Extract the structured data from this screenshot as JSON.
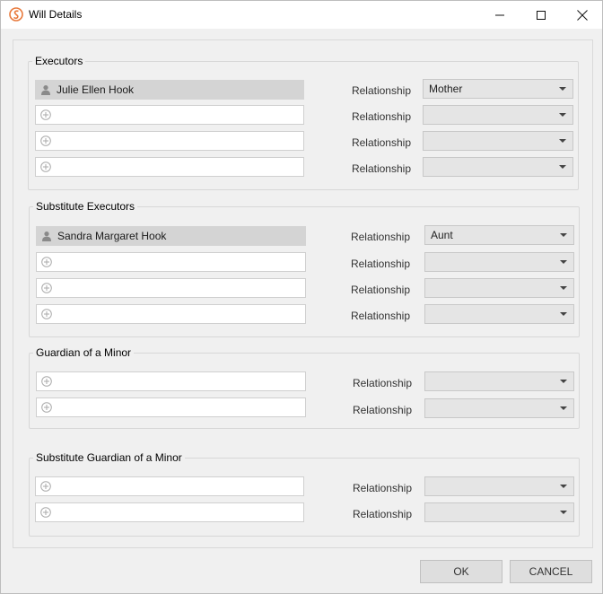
{
  "window": {
    "title": "Will Details",
    "accent_color": "#e8793b"
  },
  "sections": {
    "executors": {
      "label": "Executors",
      "rows": [
        {
          "person": "Julie Ellen Hook",
          "relationship_label": "Relationship",
          "relationship": "Mother"
        },
        {
          "person": "",
          "relationship_label": "Relationship",
          "relationship": ""
        },
        {
          "person": "",
          "relationship_label": "Relationship",
          "relationship": ""
        },
        {
          "person": "",
          "relationship_label": "Relationship",
          "relationship": ""
        }
      ]
    },
    "substitute_executors": {
      "label": "Substitute Executors",
      "rows": [
        {
          "person": "Sandra Margaret Hook",
          "relationship_label": "Relationship",
          "relationship": "Aunt"
        },
        {
          "person": "",
          "relationship_label": "Relationship",
          "relationship": ""
        },
        {
          "person": "",
          "relationship_label": "Relationship",
          "relationship": ""
        },
        {
          "person": "",
          "relationship_label": "Relationship",
          "relationship": ""
        }
      ]
    },
    "guardian": {
      "label": "Guardian of a Minor",
      "rows": [
        {
          "person": "",
          "relationship_label": "Relationship",
          "relationship": ""
        },
        {
          "person": "",
          "relationship_label": "Relationship",
          "relationship": ""
        }
      ]
    },
    "substitute_guardian": {
      "label": "Substitute Guardian of a Minor",
      "rows": [
        {
          "person": "",
          "relationship_label": "Relationship",
          "relationship": ""
        },
        {
          "person": "",
          "relationship_label": "Relationship",
          "relationship": ""
        }
      ]
    }
  },
  "buttons": {
    "ok": "OK",
    "cancel": "CANCEL"
  }
}
